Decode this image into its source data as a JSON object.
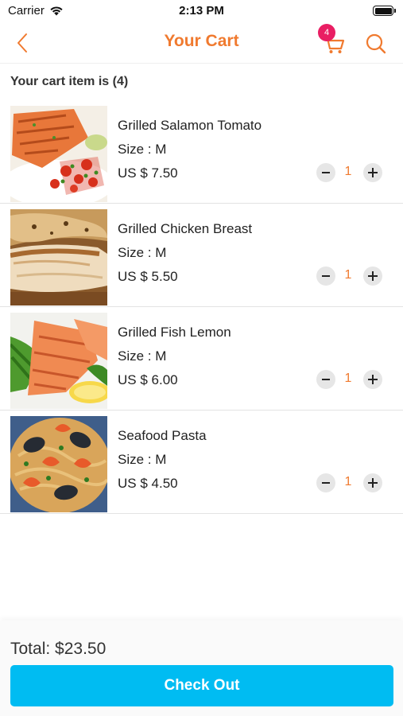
{
  "status_bar": {
    "carrier": "Carrier",
    "time": "2:13 PM"
  },
  "header": {
    "title": "Your Cart",
    "cart_badge": "4"
  },
  "cart": {
    "count_label": "Your cart item is (4)",
    "items": [
      {
        "name": "Grilled Salamon Tomato",
        "size": "Size : M",
        "price": "US $ 7.50",
        "quantity": "1"
      },
      {
        "name": "Grilled Chicken Breast",
        "size": "Size : M",
        "price": "US $ 5.50",
        "quantity": "1"
      },
      {
        "name": "Grilled Fish Lemon",
        "size": "Size : M",
        "price": "US $ 6.00",
        "quantity": "1"
      },
      {
        "name": "Seafood Pasta",
        "size": "Size : M",
        "price": "US $ 4.50",
        "quantity": "1"
      }
    ]
  },
  "footer": {
    "total": "Total: $23.50",
    "checkout_label": "Check Out"
  },
  "icons": {
    "wifi": "wifi-icon",
    "battery": "battery-icon",
    "back": "chevron-left-icon",
    "cart": "shopping-cart-icon",
    "search": "search-icon",
    "minus": "minus-icon",
    "plus": "plus-icon"
  },
  "colors": {
    "accent": "#f07a2f",
    "badge": "#e91e63",
    "checkout": "#00bcf2"
  }
}
